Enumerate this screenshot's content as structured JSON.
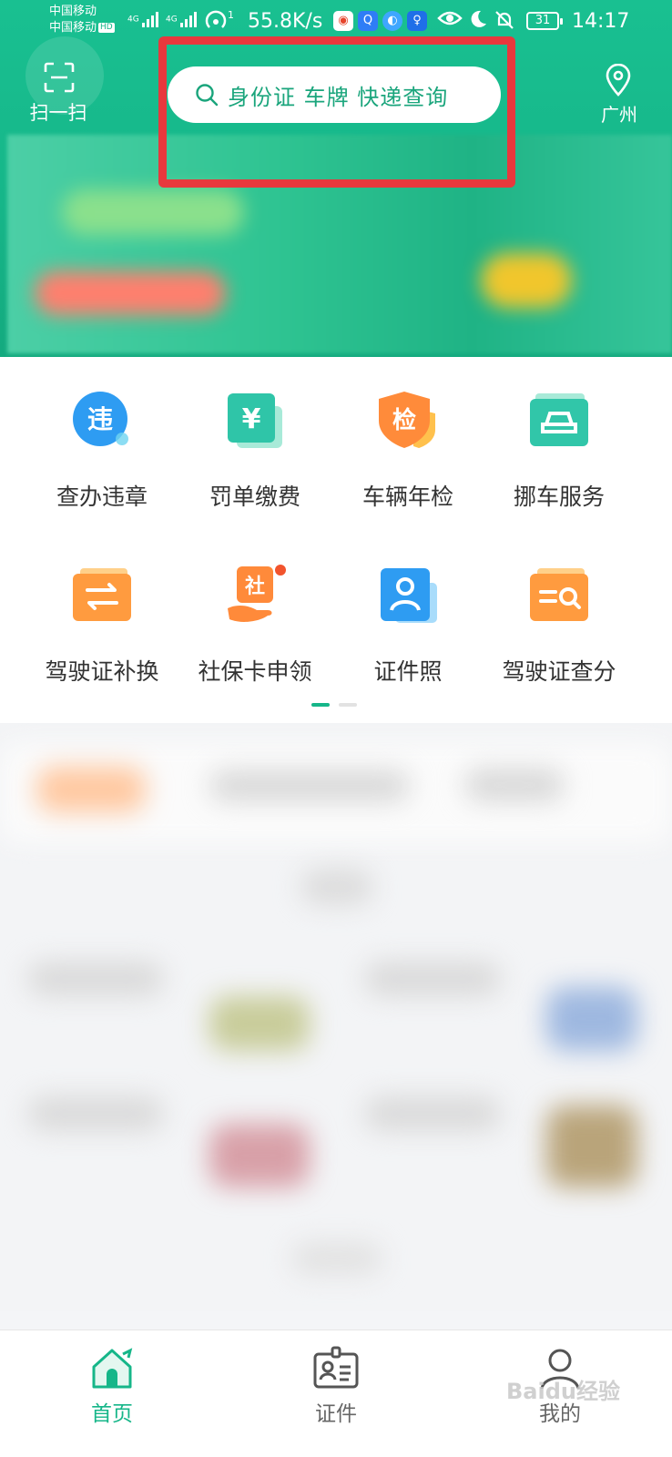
{
  "status_bar": {
    "carrier_1": "中国移动",
    "carrier_2": "中国移动",
    "hd_badge": "HD",
    "sig1_label": "4G",
    "sig2_label": "4G",
    "wifi_label": "1",
    "net_speed": "55.8K/s",
    "battery": "31",
    "time": "14:17"
  },
  "header": {
    "scan_label": "扫一扫",
    "search_placeholder": "身份证 车牌 快递查询",
    "location_label": "广州"
  },
  "services": [
    {
      "label": "查办违章",
      "icon": "violation-icon",
      "glyph": "违",
      "color": "#2e9cf2"
    },
    {
      "label": "罚单缴费",
      "icon": "fine-payment-icon",
      "glyph": "¥",
      "color": "#2fc5a8"
    },
    {
      "label": "车辆年检",
      "icon": "vehicle-inspection-icon",
      "glyph": "检",
      "color": "#ff8b3a"
    },
    {
      "label": "挪车服务",
      "icon": "move-car-icon",
      "glyph": "",
      "color": "#31c6a9"
    },
    {
      "label": "驾驶证补换",
      "icon": "license-replace-icon",
      "glyph": "⇄",
      "color": "#ff9b3f"
    },
    {
      "label": "社保卡申领",
      "icon": "social-security-icon",
      "glyph": "社",
      "color": "#ff8a3a"
    },
    {
      "label": "证件照",
      "icon": "id-photo-icon",
      "glyph": "",
      "color": "#2e9cf2"
    },
    {
      "label": "驾驶证查分",
      "icon": "license-points-icon",
      "glyph": "",
      "color": "#ff9b3f"
    }
  ],
  "page_indicator": {
    "active": 0,
    "count": 2
  },
  "tabbar": {
    "home": "首页",
    "documents": "证件",
    "mine": "我的"
  },
  "watermark": "Baidu经验",
  "colors": {
    "brand": "#16b689",
    "highlight_frame": "#e8383d",
    "active_tab": "#16b689",
    "inactive_tab": "#666666"
  }
}
